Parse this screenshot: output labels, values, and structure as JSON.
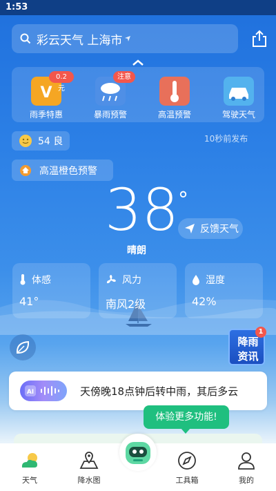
{
  "status_bar": {
    "time": "1:53"
  },
  "search": {
    "query": "彩云天气  上海市",
    "location_icon": "navigation-arrow-icon"
  },
  "quick_actions": [
    {
      "label": "雨季特惠",
      "badge": "0.2元"
    },
    {
      "label": "暴雨预警",
      "badge": "注意"
    },
    {
      "label": "高温预警",
      "badge": ""
    },
    {
      "label": "驾驶天气",
      "badge": ""
    }
  ],
  "aqi": {
    "value": "54 良"
  },
  "publish_time": "10秒前发布",
  "alert": {
    "label": "高温橙色预警"
  },
  "current": {
    "temp": "38",
    "degree": "°",
    "condition": "晴朗",
    "feedback_label": "反馈天气"
  },
  "metrics": [
    {
      "label": "体感",
      "value": "41°"
    },
    {
      "label": "风力",
      "value": "南风2级"
    },
    {
      "label": "湿度",
      "value": "42%"
    }
  ],
  "news": {
    "line1": "降雨",
    "line2": "资讯",
    "count": "1"
  },
  "forecast": {
    "ai_label": "AI",
    "text": "天傍晚18点钟后转中雨，其后多云"
  },
  "tooltip": "体验更多功能!",
  "tabs": [
    {
      "label": "天气"
    },
    {
      "label": "降水图"
    },
    {
      "label": "工具箱"
    },
    {
      "label": "我的"
    }
  ],
  "colors": {
    "accent_green": "#1fbf7f",
    "badge_red": "#f3574c",
    "sky_blue": "#2c80e6"
  }
}
